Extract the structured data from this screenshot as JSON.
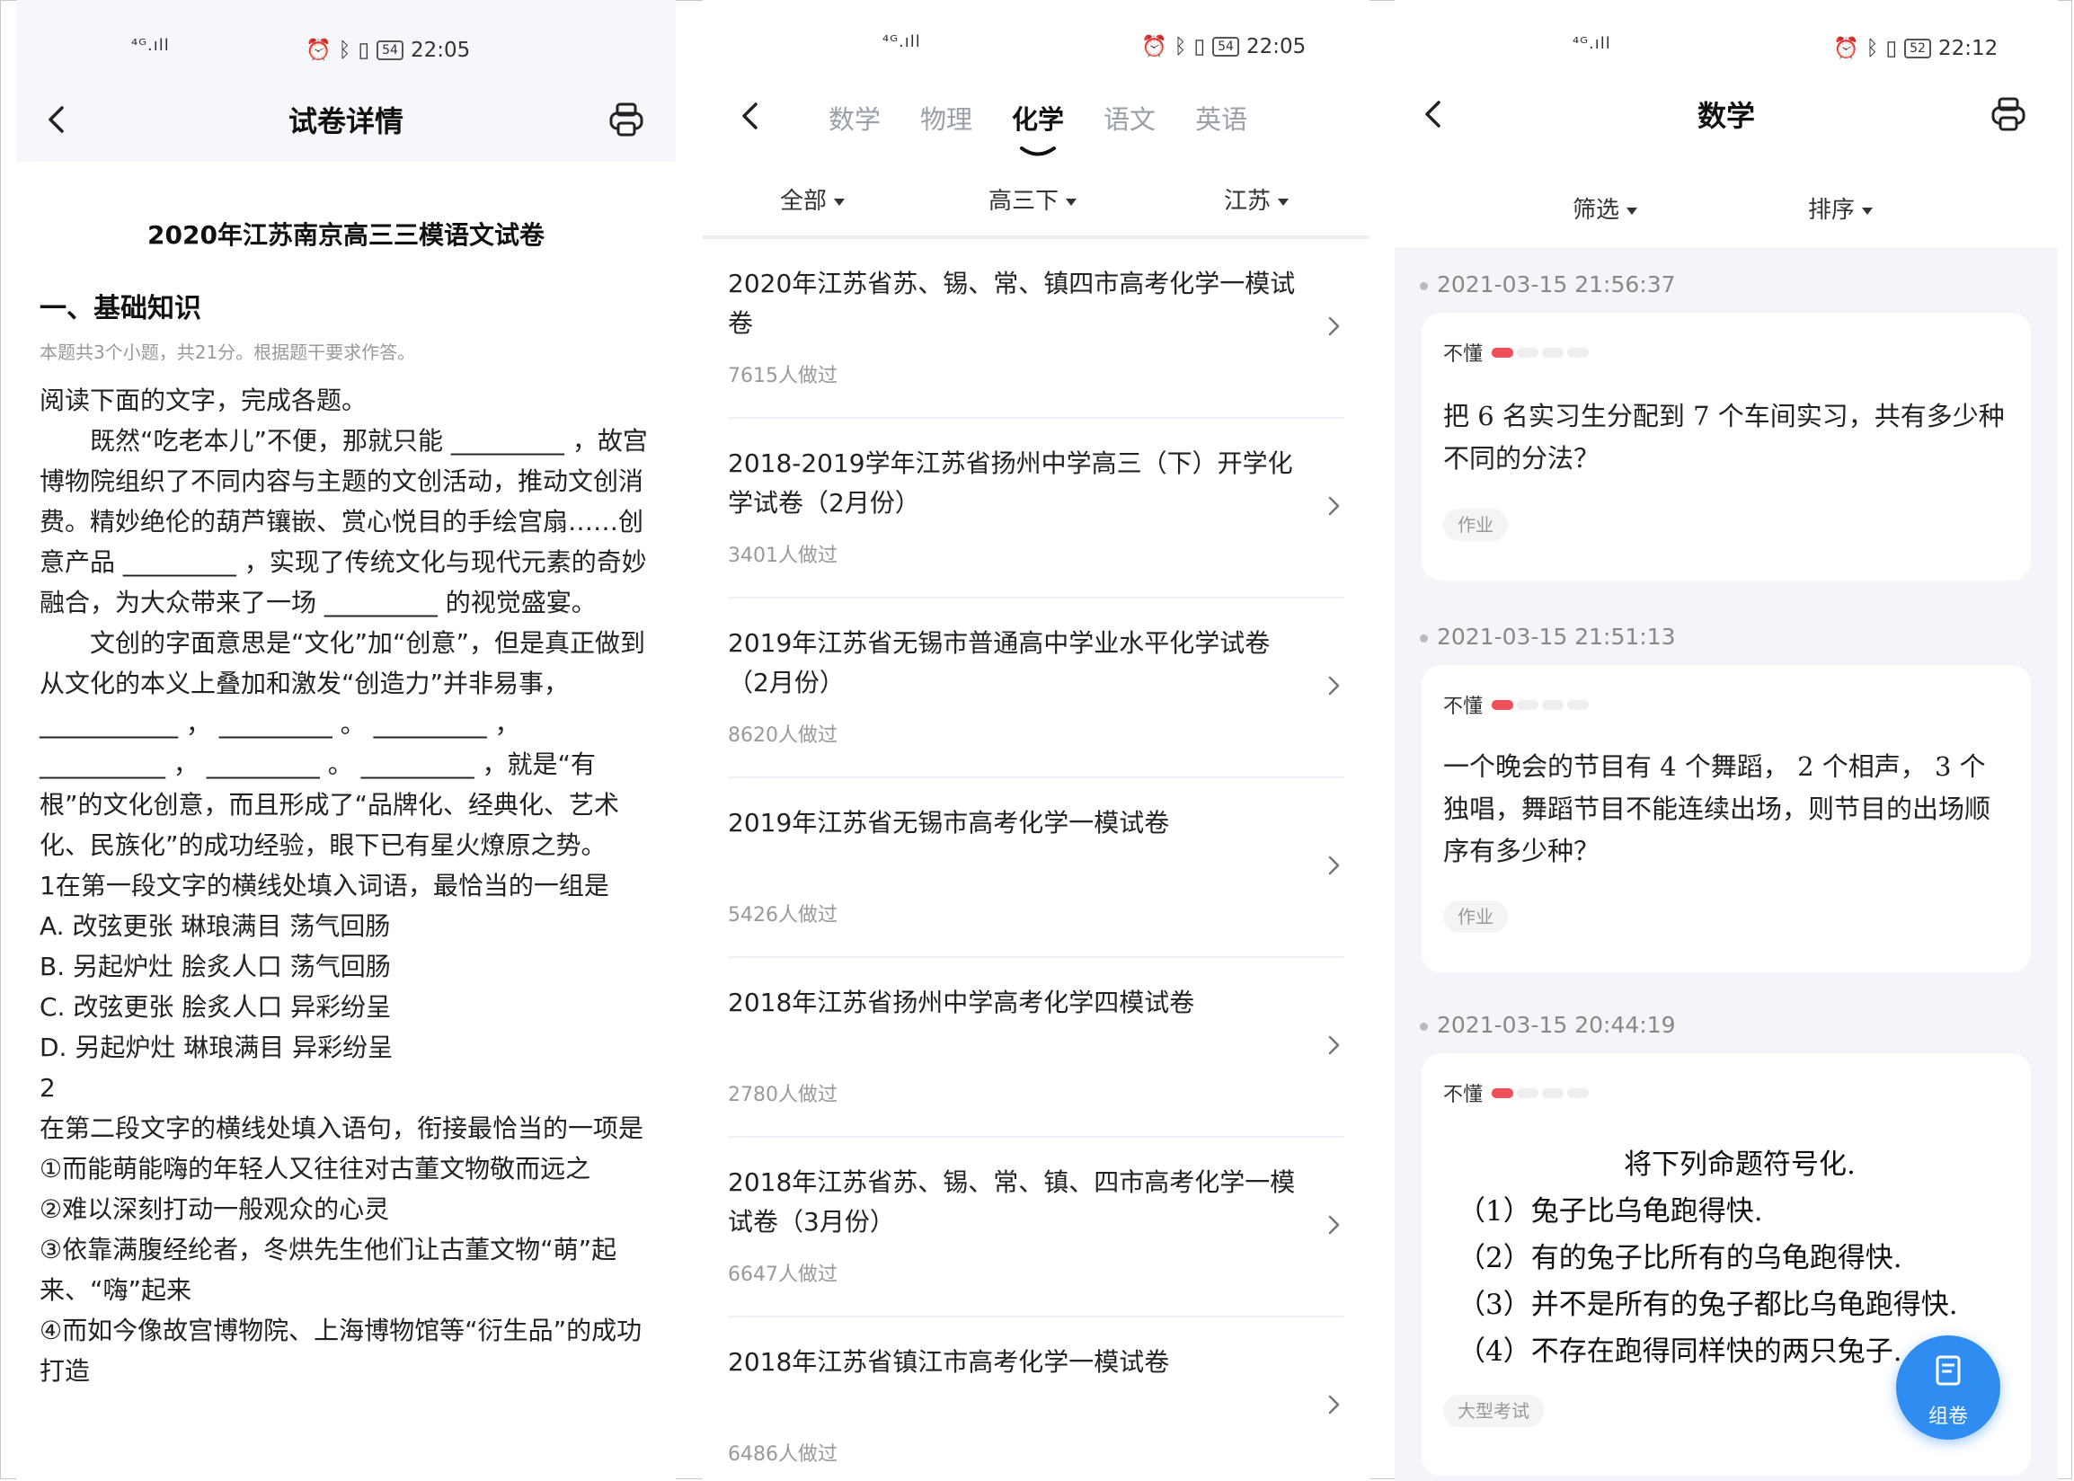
{
  "panel1": {
    "status": {
      "signal": "⁴ᴳ.ıll",
      "battery": "54",
      "time": "22:05"
    },
    "nav": {
      "title": "试卷详情"
    },
    "doc": {
      "title": "2020年江苏南京高三三模语文试卷",
      "section_title": "一、基础知识",
      "section_note": "本题共3个小题，共21分。根据题干要求作答。",
      "paragraphs": [
        "阅读下面的文字，完成各题。",
        "既然“吃老本儿”不便，那就只能 _________ ，故宫博物院组织了不同内容与主题的文创活动，推动文创消费。精妙绝伦的葫芦镶嵌、赏心悦目的手绘宫扇……创意产品 _________ ，实现了传统文化与现代元素的奇妙融合，为大众带来了一场 _________ 的视觉盛宴。",
        "文创的字面意思是“文化”加“创意”，但是真正做到从文化的本义上叠加和激发“创造力”并非易事， ___________ ， _________ 。 _________ ， __________ ， _________ 。 _________ ，就是“有根”的文化创意，而且形成了“品牌化、经典化、艺术化、民族化”的成功经验，眼下已有星火燎原之势。",
        "1在第一段文字的横线处填入词语，最恰当的一组是",
        "A. 改弦更张  琳琅满目  荡气回肠",
        "B. 另起炉灶  脍炙人口  荡气回肠",
        "C. 改弦更张  脍炙人口  异彩纷呈",
        "D. 另起炉灶  琳琅满目  异彩纷呈",
        "2",
        "在第二段文字的横线处填入语句，衔接最恰当的一项是",
        "①而能萌能嗨的年轻人又往往对古董文物敬而远之",
        "②难以深刻打动一般观众的心灵",
        "③依靠满腹经纶者，冬烘先生他们让古董文物“萌”起来、“嗨”起来",
        "④而如今像故宫博物院、上海博物馆等“衍生品”的成功打造"
      ]
    }
  },
  "panel2": {
    "status": {
      "signal": "⁴ᴳ.ıll",
      "battery": "54",
      "time": "22:05"
    },
    "tabs": [
      {
        "label": "数学",
        "active": false
      },
      {
        "label": "物理",
        "active": false
      },
      {
        "label": "化学",
        "active": true
      },
      {
        "label": "语文",
        "active": false
      },
      {
        "label": "英语",
        "active": false
      }
    ],
    "filters": [
      "全部",
      "高三下",
      "江苏"
    ],
    "items": [
      {
        "title": "2020年江苏省苏、锡、常、镇四市高考化学一模试卷",
        "meta": "7615人做过"
      },
      {
        "title": "2018-2019学年江苏省扬州中学高三（下）开学化学试卷（2月份）",
        "meta": "3401人做过"
      },
      {
        "title": "2019年江苏省无锡市普通高中学业水平化学试卷（2月份）",
        "meta": "8620人做过"
      },
      {
        "title": "2019年江苏省无锡市高考化学一模试卷",
        "meta": "5426人做过"
      },
      {
        "title": "2018年江苏省扬州中学高考化学四模试卷",
        "meta": "2780人做过"
      },
      {
        "title": "2018年江苏省苏、锡、常、镇、四市高考化学一模试卷（3月份）",
        "meta": "6647人做过"
      },
      {
        "title": "2018年江苏省镇江市高考化学一模试卷",
        "meta": "6486人做过"
      }
    ]
  },
  "panel3": {
    "status": {
      "signal": "⁴ᴳ.ıll",
      "battery": "52",
      "time": "22:12"
    },
    "nav": {
      "title": "数学"
    },
    "filters": [
      "筛选",
      "排序"
    ],
    "entries": [
      {
        "date": "2021-03-15 21:56:37",
        "badge": "不懂",
        "question": "把 6 名实习生分配到 7 个车间实习，共有多少种不同的分法？",
        "tag": "作业"
      },
      {
        "date": "2021-03-15 21:51:13",
        "badge": "不懂",
        "question": "一个晚会的节目有 4 个舞蹈， 2 个相声， 3 个独唱，舞蹈节目不能连续出场，则节目的出场顺序有多少种？",
        "tag": "作业"
      },
      {
        "date": "2021-03-15 20:44:19",
        "badge": "不懂",
        "question_lines": [
          "将下列命题符号化.",
          "（1）兔子比乌龟跑得快.",
          "（2）有的兔子比所有的乌龟跑得快.",
          "（3）并不是所有的兔子都比乌龟跑得快.",
          "（4）不存在跑得同样快的两只兔子."
        ],
        "tag": "大型考试"
      }
    ],
    "fab_label": "组卷"
  }
}
